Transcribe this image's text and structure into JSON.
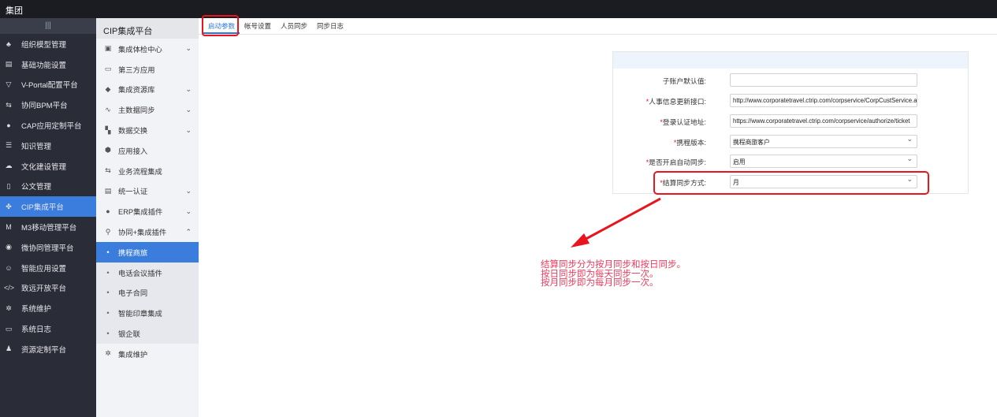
{
  "topbar": {
    "title": "集团"
  },
  "sidebar": {
    "collapse": "|||",
    "items": [
      {
        "label": "组织模型管理",
        "icon": "org-tree-icon",
        "g": "♣"
      },
      {
        "label": "基础功能设置",
        "icon": "settings-panel-icon",
        "g": "▤"
      },
      {
        "label": "V-Portal配置平台",
        "icon": "portal-icon",
        "g": "▽"
      },
      {
        "label": "协同BPM平台",
        "icon": "workflow-icon",
        "g": "⇆"
      },
      {
        "label": "CAP应用定制平台",
        "icon": "cap-icon",
        "g": "●"
      },
      {
        "label": "知识管理",
        "icon": "knowledge-icon",
        "g": "☰"
      },
      {
        "label": "文化建设管理",
        "icon": "culture-icon",
        "g": "☁"
      },
      {
        "label": "公文管理",
        "icon": "document-icon",
        "g": "▯"
      },
      {
        "label": "CIP集成平台",
        "icon": "cip-icon",
        "g": "✤",
        "active": true
      },
      {
        "label": "M3移动管理平台",
        "icon": "m3-icon",
        "g": "M"
      },
      {
        "label": "微协同管理平台",
        "icon": "wechat-icon",
        "g": "◉"
      },
      {
        "label": "智能应用设置",
        "icon": "robot-icon",
        "g": "☺"
      },
      {
        "label": "致远开放平台",
        "icon": "code-icon",
        "g": "</>"
      },
      {
        "label": "系统维护",
        "icon": "gear-icon",
        "g": "✲"
      },
      {
        "label": "系统日志",
        "icon": "log-icon",
        "g": "▭"
      },
      {
        "label": "资源定制平台",
        "icon": "resource-icon",
        "g": "♟"
      }
    ]
  },
  "subnav": {
    "title": "CIP集成平台",
    "items": [
      {
        "label": "集成体检中心",
        "icon": "checkup-icon",
        "g": "▣",
        "chev": "⌄"
      },
      {
        "label": "第三方应用",
        "icon": "monitor-icon",
        "g": "▭"
      },
      {
        "label": "集成资源库",
        "icon": "resource-lib-icon",
        "g": "◆",
        "chev": "⌄"
      },
      {
        "label": "主数据同步",
        "icon": "sync-chart-icon",
        "g": "∿",
        "chev": "⌄"
      },
      {
        "label": "数据交换",
        "icon": "exchange-icon",
        "g": "▚",
        "chev": "⌄"
      },
      {
        "label": "应用接入",
        "icon": "cube-icon",
        "g": "⬢"
      },
      {
        "label": "业务流程集成",
        "icon": "process-icon",
        "g": "⇆"
      },
      {
        "label": "统一认证",
        "icon": "auth-icon",
        "g": "▤",
        "chev": "⌄"
      },
      {
        "label": "ERP集成插件",
        "icon": "erp-icon",
        "g": "●",
        "chev": "⌄"
      },
      {
        "label": "协同+集成插件",
        "icon": "plugin-icon",
        "g": "⚲",
        "chev": "⌃"
      }
    ],
    "subitems": [
      "携程商旅",
      "电话会议插件",
      "电子合同",
      "智能印章集成",
      "银企联"
    ],
    "last": {
      "label": "集成维护",
      "icon": "gear-icon",
      "g": "✲"
    }
  },
  "tabs": [
    "启动参数",
    "帐号设置",
    "人员同步",
    "同步日志"
  ],
  "form": {
    "rows": [
      {
        "label": "子账户默认值:",
        "required": false,
        "value": "",
        "type": "input"
      },
      {
        "label": "人事信息更新接口:",
        "required": true,
        "value": "http://www.corporatetravel.ctrip.com/corpservice/CorpCustService.asmx",
        "type": "input"
      },
      {
        "label": "登录认证地址:",
        "required": true,
        "value": "https://www.corporatetravel.ctrip.com/corpservice/authorize/ticket",
        "type": "input"
      },
      {
        "label": "携程版本:",
        "required": true,
        "value": "携程商旅客户",
        "type": "select"
      },
      {
        "label": "是否开启自动同步:",
        "required": true,
        "value": "启用",
        "type": "select"
      },
      {
        "label": "结算同步方式:",
        "required": true,
        "value": "月",
        "type": "select"
      }
    ]
  },
  "annotation": {
    "lines": [
      "结算同步分为按月同步和按日同步。",
      "按日同步即为每天同步一次。",
      "按月同步即为每月同步一次。"
    ],
    "color": "#ef3a5d"
  }
}
